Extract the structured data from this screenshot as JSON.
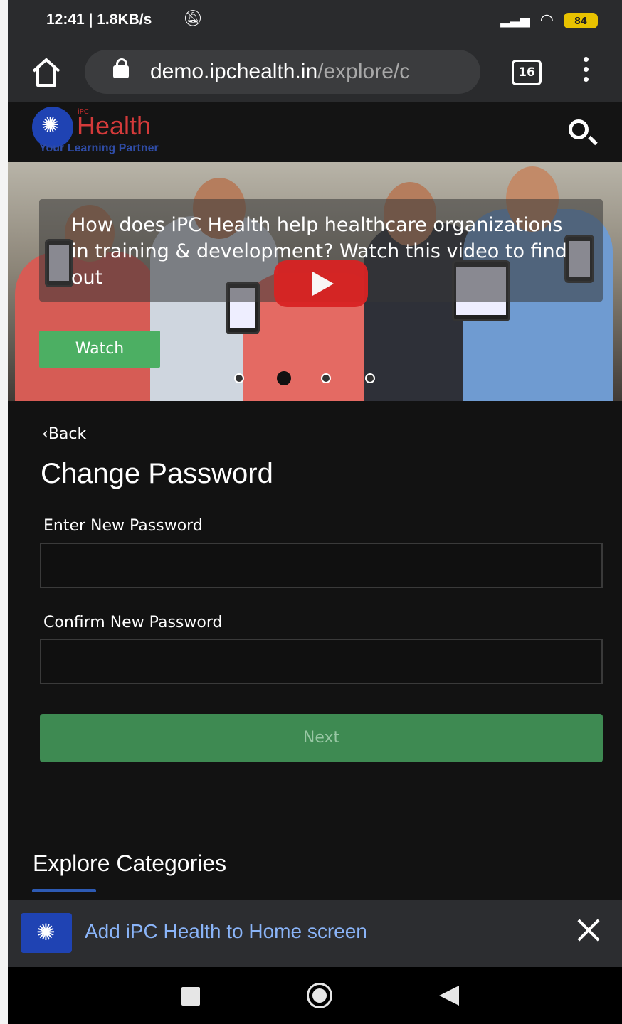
{
  "status": {
    "time": "12:41 | 1.8KB/s",
    "mute_icon": "bell-off-icon",
    "battery": "84"
  },
  "browser": {
    "url_domain": "demo.ipchealth.in",
    "url_path": "/explore/c",
    "tab_count": "16"
  },
  "site": {
    "logo_prefix": "iPC",
    "logo_name": "Health",
    "tagline": "Your Learning Partner"
  },
  "hero": {
    "caption": "How does iPC Health help healthcare organizations in training & development? Watch this video to find out",
    "watch_label": "Watch",
    "slide_count": 4,
    "active_slide": 2
  },
  "form": {
    "back_label": "Back",
    "title": "Change Password",
    "new_password_label": "Enter New Password",
    "new_password_value": "",
    "confirm_password_label": "Confirm New Password",
    "confirm_password_value": "",
    "next_label": "Next"
  },
  "explore": {
    "heading": "Explore Categories"
  },
  "a2hs": {
    "text": "Add iPC Health to Home screen"
  },
  "colors": {
    "accent_green": "#3e8a52",
    "link_blue": "#8ab4f8",
    "brand_red": "#d43a3a",
    "brand_blue": "#1f43b3"
  }
}
